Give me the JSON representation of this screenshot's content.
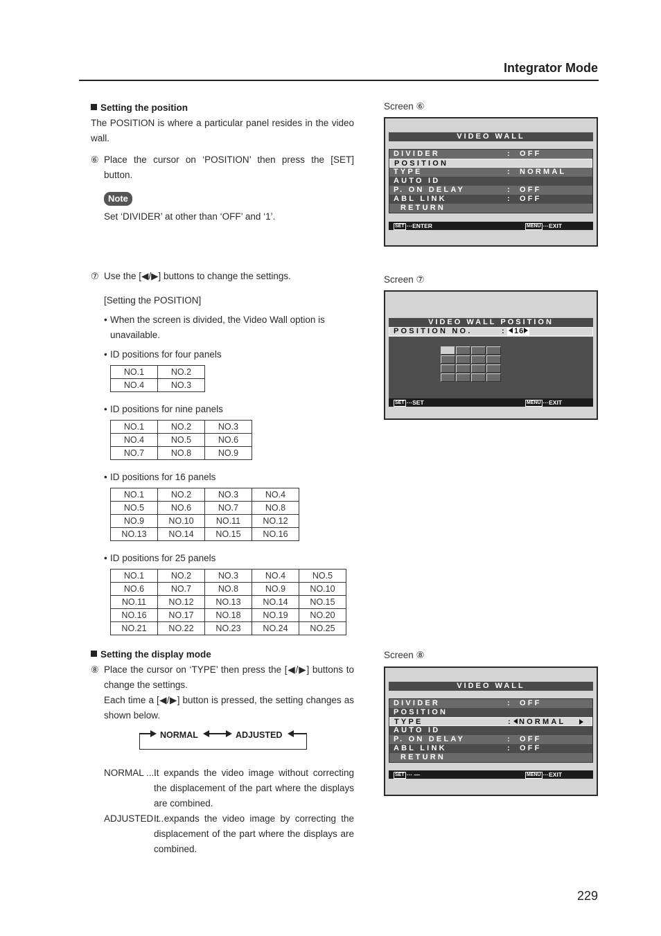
{
  "header": {
    "title": "Integrator Mode"
  },
  "page_number": "229",
  "section_position": {
    "heading": "Setting the position",
    "intro": "The POSITION is where a particular panel resides in the video wall.",
    "step6": {
      "num": "⑥",
      "text": "Place the cursor on ‘POSITION’ then press the [SET] button."
    },
    "note": {
      "badge": "Note",
      "text": "Set ‘DIVIDER’ at other than ‘OFF’ and ‘1’."
    },
    "step7": {
      "num": "⑦",
      "text": "Use the  [◀/▶] buttons to change the settings."
    },
    "sub_heading": "[Setting the POSITION]",
    "bullet_divided": "When the screen is divided, the Video Wall option is unavailable.",
    "tables": [
      {
        "caption": "ID positions for four panels",
        "rows": [
          [
            "NO.1",
            "NO.2"
          ],
          [
            "NO.4",
            "NO.3"
          ]
        ]
      },
      {
        "caption": "ID positions for nine panels",
        "rows": [
          [
            "NO.1",
            "NO.2",
            "NO.3"
          ],
          [
            "NO.4",
            "NO.5",
            "NO.6"
          ],
          [
            "NO.7",
            "NO.8",
            "NO.9"
          ]
        ]
      },
      {
        "caption": "ID positions for 16 panels",
        "rows": [
          [
            "NO.1",
            "NO.2",
            "NO.3",
            "NO.4"
          ],
          [
            "NO.5",
            "NO.6",
            "NO.7",
            "NO.8"
          ],
          [
            "NO.9",
            "NO.10",
            "NO.11",
            "NO.12"
          ],
          [
            "NO.13",
            "NO.14",
            "NO.15",
            "NO.16"
          ]
        ]
      },
      {
        "caption": "ID positions for 25 panels",
        "rows": [
          [
            "NO.1",
            "NO.2",
            "NO.3",
            "NO.4",
            "NO.5"
          ],
          [
            "NO.6",
            "NO.7",
            "NO.8",
            "NO.9",
            "NO.10"
          ],
          [
            "NO.11",
            "NO.12",
            "NO.13",
            "NO.14",
            "NO.15"
          ],
          [
            "NO.16",
            "NO.17",
            "NO.18",
            "NO.19",
            "NO.20"
          ],
          [
            "NO.21",
            "NO.22",
            "NO.23",
            "NO.24",
            "NO.25"
          ]
        ]
      }
    ]
  },
  "section_display": {
    "heading": "Setting the display mode",
    "step8": {
      "num": "⑧",
      "text": "Place the cursor on ‘TYPE’ then press the [◀/▶] buttons to change the settings."
    },
    "step8_cont": "Each time a [◀/▶] button is pressed, the setting changes as shown below.",
    "cycle": {
      "a": "NORMAL",
      "b": "ADJUSTED"
    },
    "definitions": [
      {
        "term": "NORMAL .....",
        "text": "It expands the video image without correcting the displacement of the part where the displays are combined."
      },
      {
        "term": "ADJUSTED ...",
        "text": "It expands the video image by correcting the displacement of the part where the displays are combined."
      }
    ]
  },
  "screens": {
    "s6": {
      "label": "Screen ⑥",
      "title": "VIDEO WALL",
      "rows": [
        {
          "label": "DIVIDER",
          "colon": ":",
          "value": "OFF"
        },
        {
          "label": "POSITION",
          "colon": "",
          "value": ""
        },
        {
          "label": "TYPE",
          "colon": ":",
          "value": "NORMAL"
        },
        {
          "label": "AUTO ID",
          "colon": "",
          "value": ""
        },
        {
          "label": "P. ON DELAY",
          "colon": ":",
          "value": "OFF"
        },
        {
          "label": "ABL LINK",
          "colon": ":",
          "value": "OFF"
        },
        {
          "label": "RETURN",
          "colon": "",
          "value": ""
        }
      ],
      "selected_index": 1,
      "footer_left_key": "SET",
      "footer_left": "···ENTER",
      "footer_right_key": "MENU",
      "footer_right": "···EXIT"
    },
    "s7": {
      "label": "Screen ⑦",
      "title": "VIDEO WALL POSITION",
      "row_label": "POSITION NO.",
      "colon": ":",
      "value": "16",
      "grid": {
        "cols": 4,
        "rows": 4,
        "active_cell": 1
      },
      "footer_left_key": "SET",
      "footer_left": "···SET",
      "footer_right_key": "MENU",
      "footer_right": "···EXIT"
    },
    "s8": {
      "label": "Screen ⑧",
      "title": "VIDEO WALL",
      "rows": [
        {
          "label": "DIVIDER",
          "colon": ":",
          "value": "OFF"
        },
        {
          "label": "POSITION",
          "colon": "",
          "value": ""
        },
        {
          "label": "TYPE",
          "colon": ":",
          "value": "NORMAL"
        },
        {
          "label": "AUTO ID",
          "colon": "",
          "value": ""
        },
        {
          "label": "P. ON DELAY",
          "colon": ":",
          "value": "OFF"
        },
        {
          "label": "ABL LINK",
          "colon": ":",
          "value": "OFF"
        },
        {
          "label": "RETURN",
          "colon": "",
          "value": ""
        }
      ],
      "selected_index": 2,
      "footer_left_key": "SET",
      "footer_left": "··· —",
      "footer_right_key": "MENU",
      "footer_right": "···EXIT"
    }
  }
}
